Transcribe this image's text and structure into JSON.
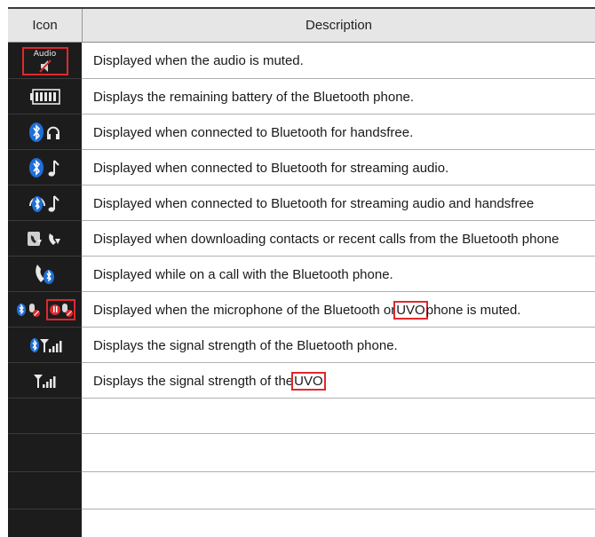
{
  "header": {
    "icon": "Icon",
    "description": "Description"
  },
  "rows": [
    {
      "icon": "audio-muted-icon",
      "icon_text": "Audio",
      "text": "Displayed when the audio is muted."
    },
    {
      "icon": "battery-icon",
      "text": "Displays the remaining battery of the Bluetooth phone."
    },
    {
      "icon": "bluetooth-handsfree-icon",
      "text": "Displayed when connected to Bluetooth for handsfree."
    },
    {
      "icon": "bluetooth-streaming-icon",
      "text": "Displayed when connected to Bluetooth for streaming audio."
    },
    {
      "icon": "bluetooth-streaming-handsfree-icon",
      "text": "Displayed when connected to Bluetooth for streaming audio and handsfree"
    },
    {
      "icon": "downloading-contacts-icon",
      "text": "Displayed when downloading contacts or recent calls from the Bluetooth phone"
    },
    {
      "icon": "call-icon",
      "text": "Displayed while on a call with the Bluetooth phone."
    },
    {
      "icon": "mic-muted-icon",
      "text_before": "Displayed when the microphone of the Bluetooth or ",
      "text_highlight": "UVO",
      "text_after": " phone is muted."
    },
    {
      "icon": "bluetooth-signal-icon",
      "text": "Displays the signal strength of the Bluetooth phone."
    },
    {
      "icon": "signal-strength-icon",
      "text_before": "Displays the signal strength of the ",
      "text_highlight": "UVO",
      "text_after": ""
    }
  ],
  "colors": {
    "highlight": "#e0282d",
    "bluetooth": "#1e6fd9",
    "icon_bg": "#1c1c1c"
  }
}
